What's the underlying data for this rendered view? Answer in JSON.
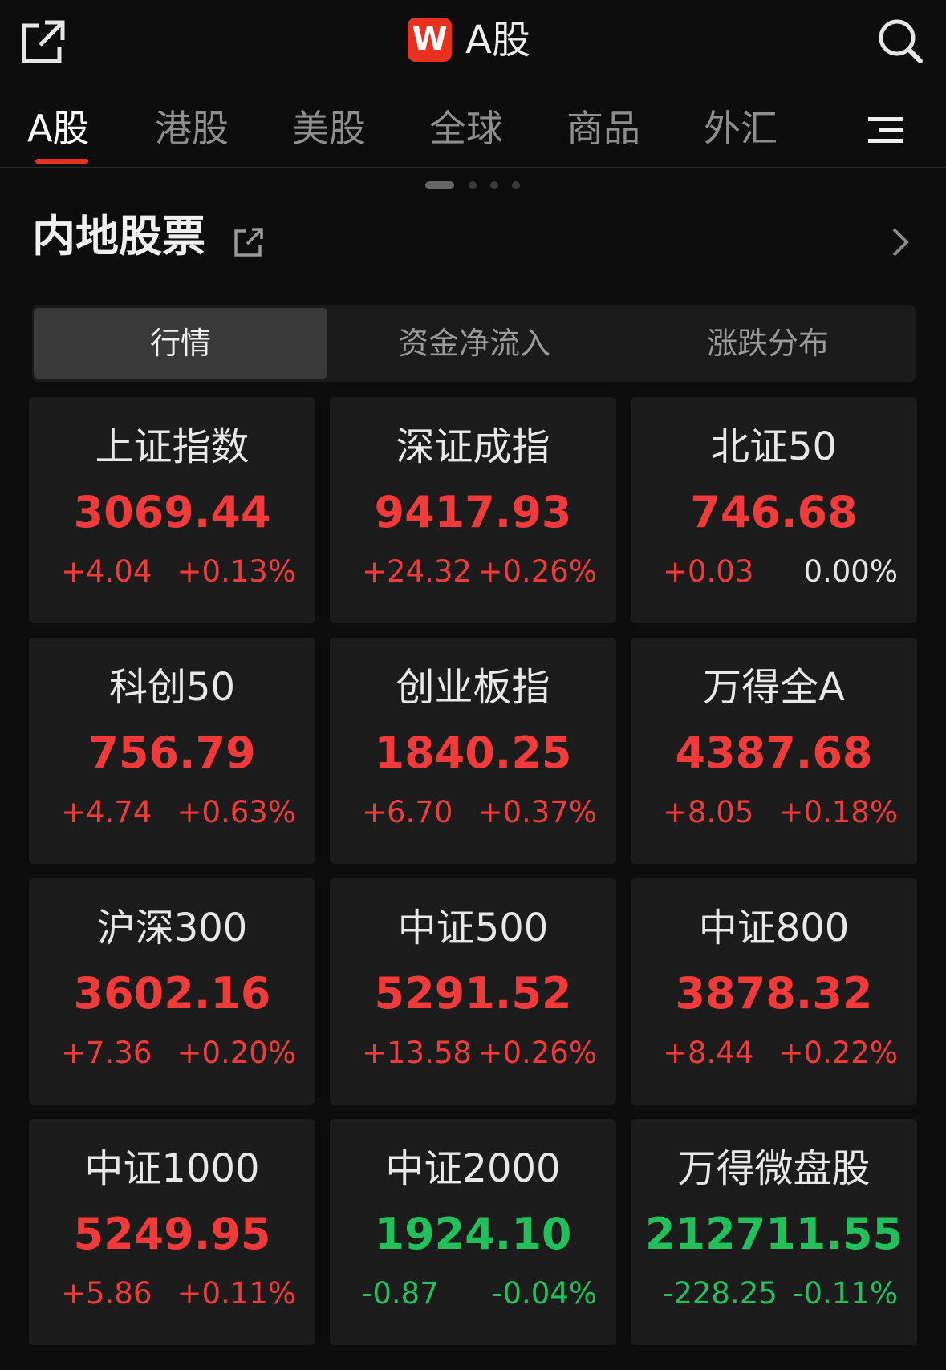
{
  "header": {
    "title": "A股",
    "logo_letter": "W",
    "share_icon": "share-icon",
    "search_icon": "search-icon"
  },
  "tabs": [
    {
      "label": "A股",
      "active": true
    },
    {
      "label": "港股",
      "active": false
    },
    {
      "label": "美股",
      "active": false
    },
    {
      "label": "全球",
      "active": false
    },
    {
      "label": "商品",
      "active": false
    },
    {
      "label": "外汇",
      "active": false
    }
  ],
  "section": {
    "title": "内地股票",
    "link_icon": "external-link-icon",
    "more_icon": "chevron-right-icon"
  },
  "segments": [
    {
      "label": "行情",
      "active": true
    },
    {
      "label": "资金净流入",
      "active": false
    },
    {
      "label": "涨跌分布",
      "active": false
    }
  ],
  "indices": [
    {
      "name": "上证指数",
      "value": "3069.44",
      "change": "+4.04",
      "pct": "+0.13%",
      "dir": "up",
      "pct_dir": "up"
    },
    {
      "name": "深证成指",
      "value": "9417.93",
      "change": "+24.32",
      "pct": "+0.26%",
      "dir": "up",
      "pct_dir": "up"
    },
    {
      "name": "北证50",
      "value": "746.68",
      "change": "+0.03",
      "pct": "0.00%",
      "dir": "up",
      "pct_dir": "flat"
    },
    {
      "name": "科创50",
      "value": "756.79",
      "change": "+4.74",
      "pct": "+0.63%",
      "dir": "up",
      "pct_dir": "up"
    },
    {
      "name": "创业板指",
      "value": "1840.25",
      "change": "+6.70",
      "pct": "+0.37%",
      "dir": "up",
      "pct_dir": "up"
    },
    {
      "name": "万得全A",
      "value": "4387.68",
      "change": "+8.05",
      "pct": "+0.18%",
      "dir": "up",
      "pct_dir": "up"
    },
    {
      "name": "沪深300",
      "value": "3602.16",
      "change": "+7.36",
      "pct": "+0.20%",
      "dir": "up",
      "pct_dir": "up"
    },
    {
      "name": "中证500",
      "value": "5291.52",
      "change": "+13.58",
      "pct": "+0.26%",
      "dir": "up",
      "pct_dir": "up"
    },
    {
      "name": "中证800",
      "value": "3878.32",
      "change": "+8.44",
      "pct": "+0.22%",
      "dir": "up",
      "pct_dir": "up"
    },
    {
      "name": "中证1000",
      "value": "5249.95",
      "change": "+5.86",
      "pct": "+0.11%",
      "dir": "up",
      "pct_dir": "up"
    },
    {
      "name": "中证2000",
      "value": "1924.10",
      "change": "-0.87",
      "pct": "-0.04%",
      "dir": "down",
      "pct_dir": "down"
    },
    {
      "name": "万得微盘股",
      "value": "212711.55",
      "change": "-228.25",
      "pct": "-0.11%",
      "dir": "down",
      "pct_dir": "down"
    }
  ],
  "colors": {
    "up": "#f23a3a",
    "down": "#22c05a",
    "accent": "#e8311f"
  }
}
